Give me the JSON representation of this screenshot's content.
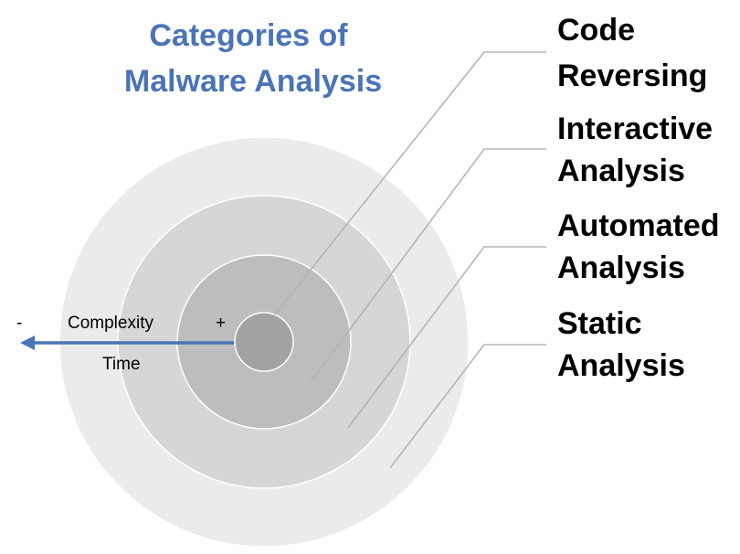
{
  "title": {
    "line1": "Categories of",
    "line2": "Malware Analysis",
    "color": "#4a74b8"
  },
  "layers": [
    {
      "id": "code-reversing",
      "line1": "Code",
      "line2": "Reversing",
      "fill": "#a3a3a3"
    },
    {
      "id": "interactive-analysis",
      "line1": "Interactive",
      "line2": "Analysis",
      "fill": "#bdbdbd"
    },
    {
      "id": "automated-analysis",
      "line1": "Automated",
      "line2": "Analysis",
      "fill": "#d6d6d6"
    },
    {
      "id": "static-analysis",
      "line1": "Static",
      "line2": "Analysis",
      "fill": "#ebebeb"
    }
  ],
  "axis": {
    "minus": "-",
    "complexity": "Complexity",
    "plus": "+",
    "time": "Time",
    "arrow_color": "#4a74b8"
  },
  "colors": {
    "leader_line": "#b5b5b5",
    "circle_stroke": "#ffffff"
  }
}
